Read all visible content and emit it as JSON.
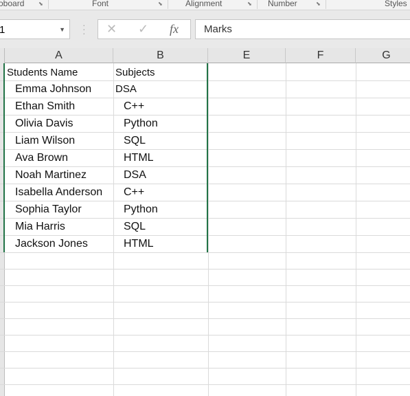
{
  "ribbon": {
    "groups": [
      "oboard",
      "Font",
      "Alignment",
      "Number",
      "Styles"
    ]
  },
  "name_box": {
    "value": "1"
  },
  "formula_bar": {
    "cancel_icon": "✕",
    "enter_icon": "✓",
    "fx_label": "fx",
    "value": "Marks"
  },
  "columns": [
    "A",
    "B",
    "E",
    "F",
    "G"
  ],
  "sheet": {
    "headers": [
      "Students Name",
      "Subjects"
    ],
    "rows": [
      [
        "Emma Johnson",
        "DSA"
      ],
      [
        "Ethan Smith",
        "C++"
      ],
      [
        "Olivia Davis",
        "Python"
      ],
      [
        "Liam Wilson",
        "SQL"
      ],
      [
        "Ava Brown",
        "HTML"
      ],
      [
        "Noah Martinez",
        "DSA"
      ],
      [
        "Isabella Anderson",
        "C++"
      ],
      [
        "Sophia Taylor",
        "Python"
      ],
      [
        "Mia Harris",
        "SQL"
      ],
      [
        "Jackson Jones",
        "HTML"
      ]
    ]
  },
  "colors": {
    "selection": "#217346"
  }
}
